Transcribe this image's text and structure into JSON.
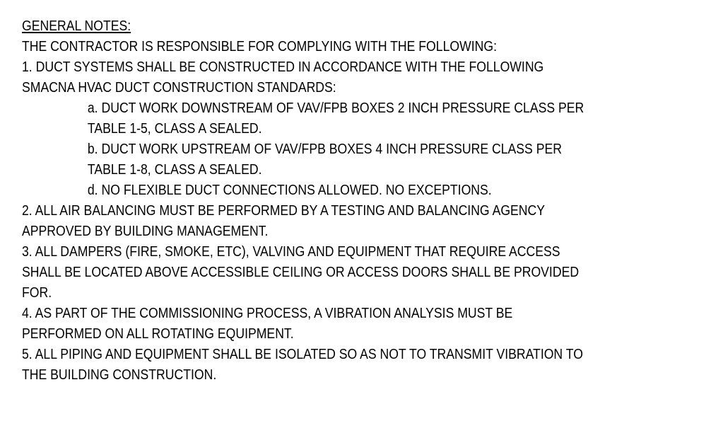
{
  "heading": "GENERAL NOTES:",
  "intro": "THE CONTRACTOR IS RESPONSIBLE FOR COMPLYING WITH THE FOLLOWING:",
  "notes": [
    {
      "lines": [
        "1. DUCT SYSTEMS SHALL BE CONSTRUCTED IN ACCORDANCE WITH THE FOLLOWING",
        "SMACNA HVAC DUCT CONSTRUCTION STANDARDS:"
      ],
      "subitems": [
        {
          "lines": [
            "a. DUCT WORK DOWNSTREAM OF VAV/FPB BOXES 2 INCH PRESSURE CLASS PER",
            "TABLE 1-5, CLASS A SEALED."
          ]
        },
        {
          "lines": [
            "b. DUCT WORK UPSTREAM OF VAV/FPB BOXES 4 INCH PRESSURE CLASS PER",
            "TABLE 1-8, CLASS A SEALED."
          ]
        },
        {
          "lines": [
            "d. NO FLEXIBLE DUCT CONNECTIONS ALLOWED. NO EXCEPTIONS."
          ]
        }
      ]
    },
    {
      "lines": [
        "2. ALL AIR BALANCING MUST BE PERFORMED BY A TESTING AND BALANCING AGENCY",
        "APPROVED BY BUILDING MANAGEMENT."
      ]
    },
    {
      "lines": [
        "3. ALL DAMPERS (FIRE, SMOKE, ETC), VALVING AND EQUIPMENT THAT REQUIRE ACCESS",
        "SHALL BE LOCATED ABOVE ACCESSIBLE CEILING OR ACCESS DOORS SHALL BE PROVIDED",
        "FOR."
      ]
    },
    {
      "lines": [
        "4. AS PART OF THE COMMISSIONING PROCESS, A VIBRATION ANALYSIS MUST BE",
        "PERFORMED ON ALL ROTATING EQUIPMENT."
      ]
    },
    {
      "lines": [
        "5. ALL PIPING AND EQUIPMENT SHALL BE ISOLATED SO AS NOT TO TRANSMIT VIBRATION TO",
        "THE BUILDING CONSTRUCTION."
      ]
    }
  ]
}
